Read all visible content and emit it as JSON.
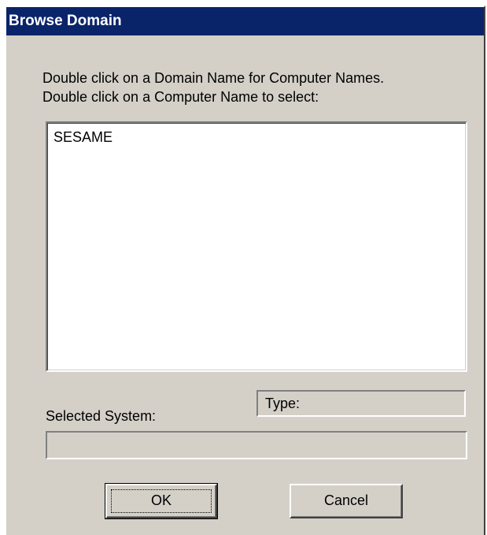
{
  "window": {
    "title": "Browse Domain"
  },
  "instructions": {
    "line1": "Double click on a Domain Name for Computer Names.",
    "line2": "Double click on a Computer Name to select:"
  },
  "domain_list": {
    "items": [
      "SESAME"
    ]
  },
  "selected_system": {
    "label": "Selected System:",
    "value": ""
  },
  "type_field": {
    "label": "Type:"
  },
  "buttons": {
    "ok_label": "OK",
    "cancel_label": "Cancel"
  },
  "colors": {
    "title_bar": "#0a246a",
    "dialog_face": "#d4d0c8"
  }
}
